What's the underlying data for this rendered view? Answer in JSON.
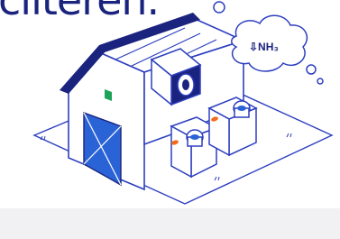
{
  "headline": {
    "text": "cilteren."
  },
  "cloud": {
    "label": "⇩NH₃"
  },
  "colors": {
    "navy": "#1a237e",
    "line": "#2d3fbf",
    "accent_blue": "#2a63d6",
    "window_green": "#1fa35a",
    "orange": "#f26a1b",
    "footer_bg": "#f1f1f3"
  },
  "icons": [
    "ammonia-cloud-icon",
    "barn-icon",
    "air-scrubber-icon",
    "ventilation-fan-icon"
  ]
}
